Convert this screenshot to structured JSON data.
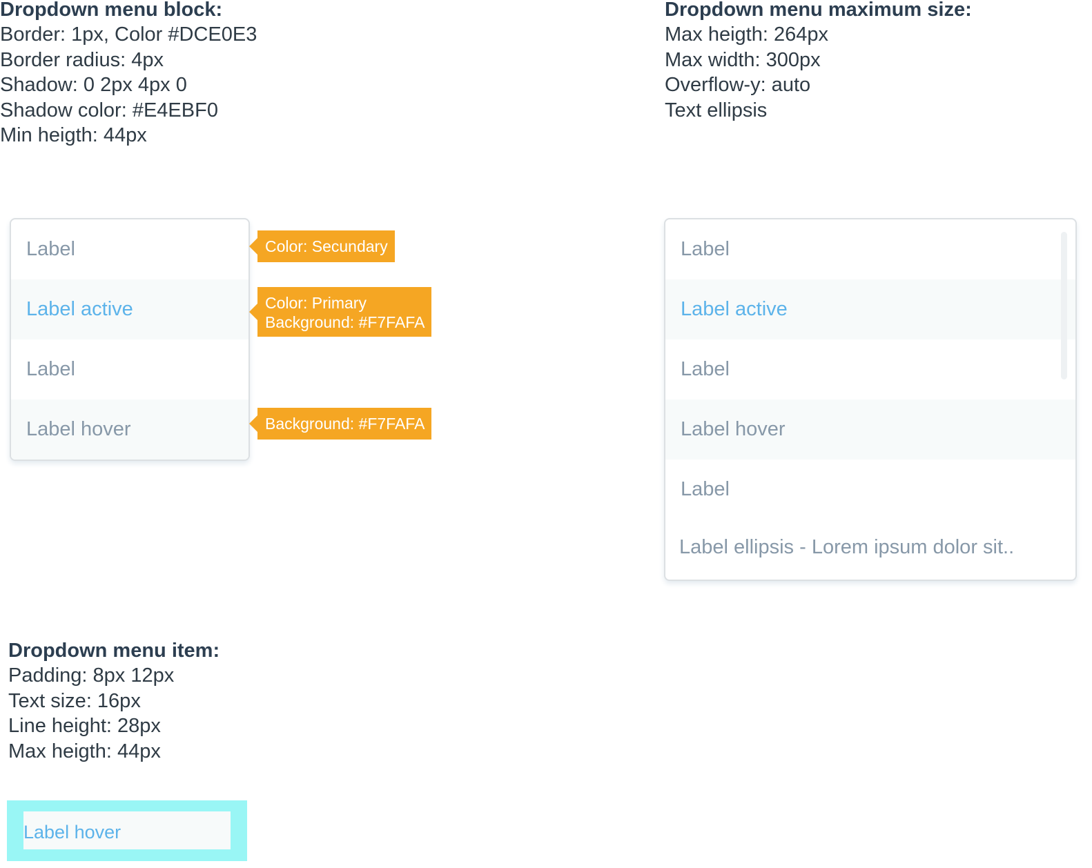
{
  "block_spec": {
    "title": "Dropdown menu block:",
    "lines": [
      "Border: 1px, Color #DCE0E3",
      "Border radius: 4px",
      "Shadow: 0 2px 4px 0",
      "Shadow color: #E4EBF0",
      "Min heigth: 44px"
    ]
  },
  "max_spec": {
    "title": "Dropdown menu maximum size:",
    "lines": [
      "Max heigth: 264px",
      "Max width: 300px",
      "Overflow-y: auto",
      "Text ellipsis"
    ]
  },
  "item_spec": {
    "title": "Dropdown menu item:",
    "lines": [
      "Padding: 8px 12px",
      "Text size: 16px",
      "Line height: 28px",
      "Max heigth: 44px"
    ]
  },
  "menu_small": {
    "items": [
      "Label",
      "Label active",
      "Label",
      "Label hover"
    ]
  },
  "menu_large": {
    "items": [
      "Label",
      "Label active",
      "Label",
      "Label hover",
      "Label",
      "Label ellipsis - Lorem ipsum dolor sit.."
    ]
  },
  "callouts": {
    "secondary": "Color: Secundary",
    "primary_color": "Color: Primary",
    "primary_bg": "Background: #F7FAFA",
    "hover_bg": "Background: #F7FAFA"
  },
  "demo": {
    "label": "Label hover"
  },
  "colors": {
    "border": "#DCE0E3",
    "shadow": "#E4EBF0",
    "active_bg": "#F7FAFA",
    "primary": "#5CB3EA",
    "secondary": "#8798A8",
    "callout": "#F5A623",
    "demo_highlight": "#99F6F5"
  }
}
